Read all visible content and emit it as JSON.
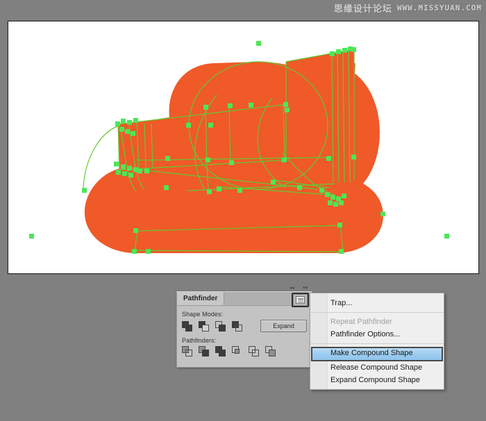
{
  "watermark": {
    "cn_text": "思缘设计论坛",
    "url_text": "WWW.MISSYUAN.COM"
  },
  "canvas": {
    "name": "illustrator-artboard",
    "background_color": "#ffffff",
    "artwork": {
      "name": "cloud-shape",
      "fill_color": "#ef5a28",
      "path_stroke_color": "#5ec22f",
      "anchor_color": "#46e858",
      "description": "Orange cloud vector artwork with selected paths and anchor points"
    }
  },
  "panel": {
    "title": "Pathfinder",
    "menu_button_icon": "panel-menu-icon",
    "collapse_icons": [
      "double-arrow-left-icon",
      "double-arrow-right-icon"
    ],
    "shape_modes_label": "Shape Modes:",
    "shape_modes": [
      "unite-icon",
      "minus-front-icon",
      "intersect-icon",
      "exclude-icon"
    ],
    "expand_label": "Expand",
    "pathfinders_label": "Pathfinders:",
    "pathfinders": [
      "divide-icon",
      "trim-icon",
      "merge-icon",
      "crop-icon",
      "outline-icon",
      "minus-back-icon"
    ]
  },
  "context_menu": {
    "name": "pathfinder-panel-menu",
    "highlight_color": "#9dccef",
    "items": [
      {
        "label": "Trap...",
        "state": "normal"
      },
      {
        "label": "Repeat Pathfinder",
        "state": "disabled"
      },
      {
        "label": "Pathfinder Options...",
        "state": "normal"
      },
      {
        "label": "Make Compound Shape",
        "state": "selected"
      },
      {
        "label": "Release Compound Shape",
        "state": "normal"
      },
      {
        "label": "Expand Compound Shape",
        "state": "normal"
      }
    ]
  }
}
